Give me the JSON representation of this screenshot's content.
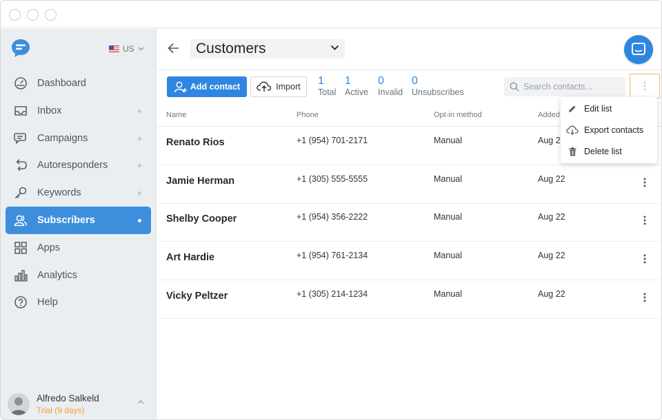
{
  "sidebar": {
    "locale": "US",
    "nav": [
      {
        "label": "Dashboard",
        "icon": "dashboard-icon",
        "dot": false,
        "active": false
      },
      {
        "label": "Inbox",
        "icon": "inbox-icon",
        "dot": true,
        "active": false
      },
      {
        "label": "Campaigns",
        "icon": "campaigns-icon",
        "dot": true,
        "active": false
      },
      {
        "label": "Autoresponders",
        "icon": "autoresponders-icon",
        "dot": true,
        "active": false
      },
      {
        "label": "Keywords",
        "icon": "key-icon",
        "dot": true,
        "active": false
      },
      {
        "label": "Subscribers",
        "icon": "subscribers-icon",
        "dot": true,
        "active": true
      },
      {
        "label": "Apps",
        "icon": "apps-icon",
        "dot": false,
        "active": false
      },
      {
        "label": "Analytics",
        "icon": "analytics-icon",
        "dot": false,
        "active": false
      },
      {
        "label": "Help",
        "icon": "help-icon",
        "dot": false,
        "active": false
      }
    ],
    "user": {
      "name": "Alfredo Salkeld",
      "plan": "Trial (9 days)"
    }
  },
  "header": {
    "list_name": "Customers"
  },
  "toolbar": {
    "add_label": "Add contact",
    "import_label": "Import",
    "stats": [
      {
        "value": "1",
        "label": "Total"
      },
      {
        "value": "1",
        "label": "Active"
      },
      {
        "value": "0",
        "label": "Invalid"
      },
      {
        "value": "0",
        "label": "Unsubscribes"
      }
    ],
    "search_placeholder": "Search contacts..."
  },
  "table": {
    "columns": [
      "Name",
      "Phone",
      "Opt-in method",
      "Added"
    ],
    "rows": [
      {
        "name": "Renato Rios",
        "phone": "+1 (954) 701-2171",
        "optin": "Manual",
        "added": "Aug 22"
      },
      {
        "name": "Jamie Herman",
        "phone": "+1 (305) 555-5555",
        "optin": "Manual",
        "added": "Aug 22"
      },
      {
        "name": "Shelby Cooper",
        "phone": "+1 (954) 356-2222",
        "optin": "Manual",
        "added": "Aug 22"
      },
      {
        "name": "Art Hardie",
        "phone": "+1 (954) 761-2134",
        "optin": "Manual",
        "added": "Aug 22"
      },
      {
        "name": "Vicky Peltzer",
        "phone": "+1 (305) 214-1234",
        "optin": "Manual",
        "added": "Aug 22"
      }
    ]
  },
  "menu": {
    "items": [
      {
        "label": "Edit list",
        "icon": "pencil-icon"
      },
      {
        "label": "Export contacts",
        "icon": "cloud-download-icon"
      },
      {
        "label": "Delete list",
        "icon": "trash-icon"
      }
    ]
  },
  "colors": {
    "accent": "#2f86e0",
    "active_nav": "#3d8fde",
    "trial": "#f0a030",
    "highlight": "#f0b669"
  }
}
